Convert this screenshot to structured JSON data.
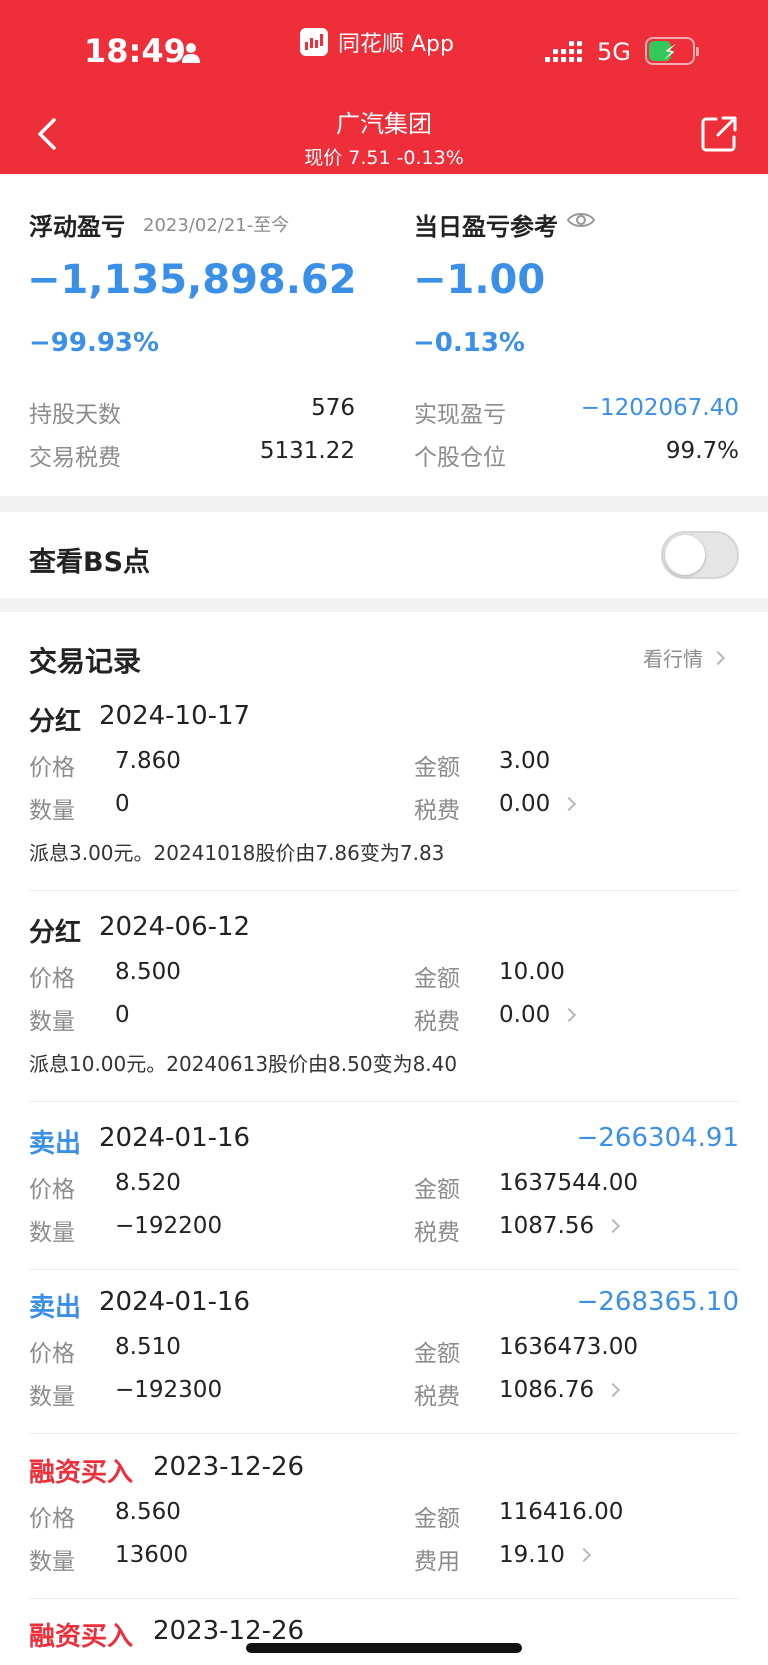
{
  "status_bar": {
    "time": "18:49",
    "app_name": "同花顺 App",
    "network": "5G"
  },
  "nav": {
    "title": "广汽集团",
    "subtitle": "现价 7.51 -0.13%"
  },
  "summary": {
    "floating_label": "浮动盈亏",
    "floating_date": "2023/02/21-至今",
    "floating_value": "−1,135,898.62",
    "floating_pct": "−99.93%",
    "daily_label": "当日盈亏参考",
    "daily_value": "−1.00",
    "daily_pct": "−0.13%",
    "hold_days_label": "持股天数",
    "hold_days_value": "576",
    "tax_label": "交易税费",
    "tax_value": "5131.22",
    "realized_label": "实现盈亏",
    "realized_value": "−1202067.40",
    "position_label": "个股仓位",
    "position_value": "99.7%"
  },
  "bs_toggle": {
    "label": "查看BS点",
    "on": false
  },
  "records": {
    "title": "交易记录",
    "market_link": "看行情",
    "items": [
      {
        "type": "分红",
        "date": "2024-10-17",
        "pnl": "",
        "price_label": "价格",
        "price": "7.860",
        "amount_label": "金额",
        "amount": "3.00",
        "qty_label": "数量",
        "qty": "0",
        "fee_label": "税费",
        "fee": "0.00",
        "note": "派息3.00元。20241018股价由7.86变为7.83"
      },
      {
        "type": "分红",
        "date": "2024-06-12",
        "pnl": "",
        "price_label": "价格",
        "price": "8.500",
        "amount_label": "金额",
        "amount": "10.00",
        "qty_label": "数量",
        "qty": "0",
        "fee_label": "税费",
        "fee": "0.00",
        "note": "派息10.00元。20240613股价由8.50变为8.40"
      },
      {
        "type": "卖出",
        "date": "2024-01-16",
        "pnl": "−266304.91",
        "price_label": "价格",
        "price": "8.520",
        "amount_label": "金额",
        "amount": "1637544.00",
        "qty_label": "数量",
        "qty": "−192200",
        "fee_label": "税费",
        "fee": "1087.56",
        "note": ""
      },
      {
        "type": "卖出",
        "date": "2024-01-16",
        "pnl": "−268365.10",
        "price_label": "价格",
        "price": "8.510",
        "amount_label": "金额",
        "amount": "1636473.00",
        "qty_label": "数量",
        "qty": "−192300",
        "fee_label": "税费",
        "fee": "1086.76",
        "note": ""
      },
      {
        "type": "融资买入",
        "date": "2023-12-26",
        "pnl": "",
        "price_label": "价格",
        "price": "8.560",
        "amount_label": "金额",
        "amount": "116416.00",
        "qty_label": "数量",
        "qty": "13600",
        "fee_label": "费用",
        "fee": "19.10",
        "note": ""
      },
      {
        "type": "融资买入",
        "date": "2023-12-26"
      }
    ]
  },
  "colors": {
    "brand_red": "#ee2f3a",
    "loss_blue": "#3a8fe8",
    "label_gray": "#8c8c8c"
  },
  "icons": [
    "person-icon",
    "app-logo-icon",
    "signal-icon",
    "battery-charging-icon",
    "back-arrow-icon",
    "share-icon",
    "eye-icon",
    "chevron-right-icon"
  ]
}
